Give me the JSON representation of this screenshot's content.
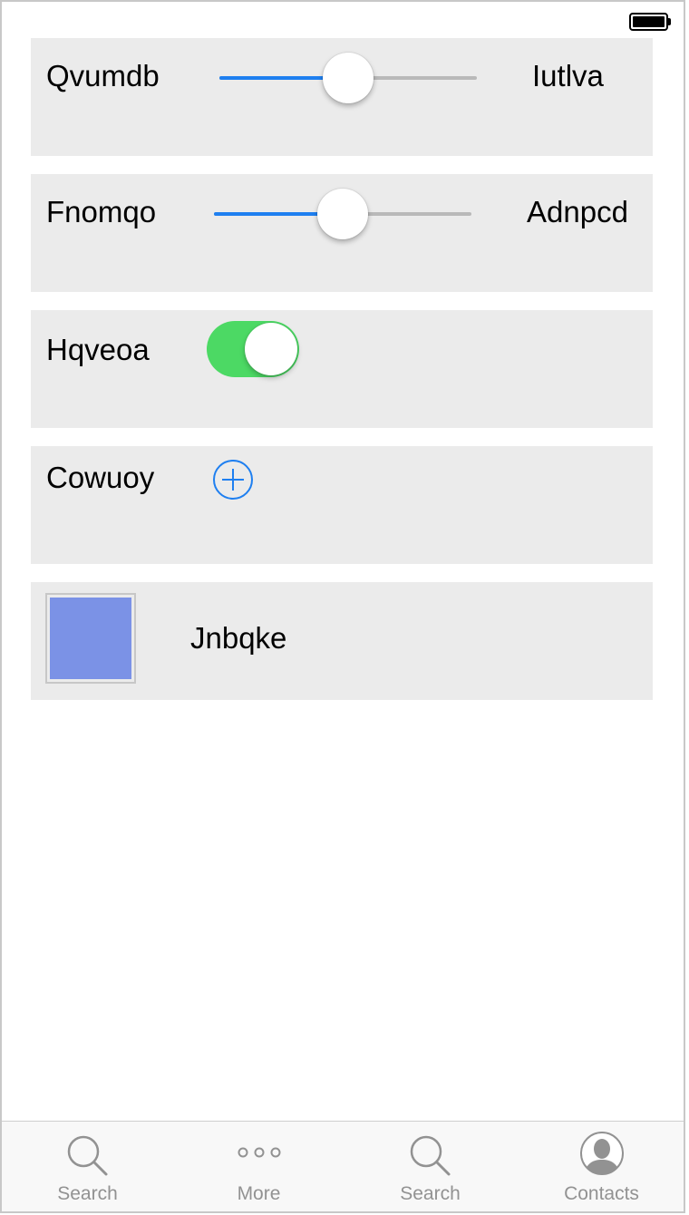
{
  "colors": {
    "accent": "#1e7ff0",
    "toggle_on": "#4cd964",
    "card_bg": "#ebebeb",
    "swatch": "#7b92e6",
    "tab_inactive": "#929292"
  },
  "rows": {
    "slider1": {
      "label": "Qvumdb",
      "value_label": "Iutlva",
      "value": 0.5
    },
    "slider2": {
      "label": "Fnomqo",
      "value_label": "Adnpcd",
      "value": 0.5
    },
    "toggle": {
      "label": "Hqveoa",
      "on": true
    },
    "add": {
      "label": "Cowuoy",
      "icon": "plus-circle-icon"
    },
    "color": {
      "label": "Jnbqke",
      "swatch_color": "#7b92e6"
    }
  },
  "tabs": [
    {
      "label": "Search",
      "icon": "search-icon"
    },
    {
      "label": "More",
      "icon": "more-icon"
    },
    {
      "label": "Search",
      "icon": "search-icon"
    },
    {
      "label": "Contacts",
      "icon": "contacts-icon"
    }
  ]
}
